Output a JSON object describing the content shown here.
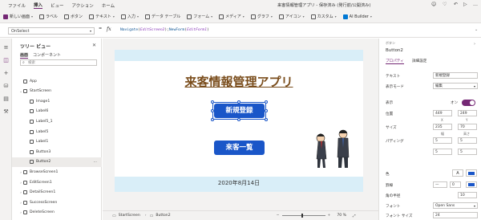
{
  "titlebar": {
    "menus": [
      "ファイル",
      "挿入",
      "ビュー",
      "アクション",
      "ホーム"
    ],
    "active_menu": "挿入",
    "doc_title": "来客情報管理アプリ - 保存済み (発行前/公開済み)"
  },
  "ribbon": {
    "items": [
      {
        "label": "新しい画面",
        "icon": "new-screen-icon",
        "color": "#742774"
      },
      {
        "label": "ラベル",
        "icon": "label-icon",
        "color": "#555555"
      },
      {
        "label": "ボタン",
        "icon": "button-icon",
        "color": "#555555"
      },
      {
        "label": "テキスト",
        "icon": "text-icon",
        "color": "#555555"
      },
      {
        "label": "入力",
        "icon": "input-icon",
        "color": "#555555"
      },
      {
        "label": "データ テーブル",
        "icon": "data-table-icon",
        "color": "#555555"
      },
      {
        "label": "フォーム",
        "icon": "form-icon",
        "color": "#555555"
      },
      {
        "label": "メディア",
        "icon": "media-icon",
        "color": "#555555"
      },
      {
        "label": "グラフ",
        "icon": "chart-icon",
        "color": "#555555"
      },
      {
        "label": "アイコン",
        "icon": "icons-icon",
        "color": "#555555"
      },
      {
        "label": "カスタム",
        "icon": "custom-icon",
        "color": "#555555"
      },
      {
        "label": "AI Builder",
        "icon": "ai-builder-icon",
        "color": "#0078d4"
      }
    ]
  },
  "formula": {
    "property": "OnSelect",
    "equals": "=",
    "fx": "fx",
    "func1": "Navigate",
    "arg1": "EditScreen2",
    "func2": "NewForm",
    "arg2": "EditForm1"
  },
  "tree": {
    "title": "ツリー ビュー",
    "tabs": [
      "画面",
      "コンポーネント"
    ],
    "search_placeholder": "検索",
    "items": [
      {
        "label": "App",
        "level": 0
      },
      {
        "label": "StartScreen",
        "level": 0
      },
      {
        "label": "Image1",
        "level": 1
      },
      {
        "label": "Label6",
        "level": 1
      },
      {
        "label": "Label5_1",
        "level": 1
      },
      {
        "label": "Label5",
        "level": 1
      },
      {
        "label": "Label1",
        "level": 1
      },
      {
        "label": "Button3",
        "level": 1
      },
      {
        "label": "Button2",
        "level": 1,
        "selected": true
      },
      {
        "label": "BrowseScreen1",
        "level": 0
      },
      {
        "label": "EditScreen1",
        "level": 0
      },
      {
        "label": "DetailScreen1",
        "level": 0
      },
      {
        "label": "SuccessScreen",
        "level": 0
      },
      {
        "label": "DeleteScreen",
        "level": 0
      }
    ]
  },
  "app": {
    "title": "来客情報管理アプリ",
    "register_button": "新規登録",
    "list_button": "来客一覧",
    "date": "2020年8月14日"
  },
  "statusbar": {
    "screen": "StartScreen",
    "control": "Button2",
    "zoom": "70 %"
  },
  "props": {
    "type": "ボタン",
    "name": "Button2",
    "tabs": [
      "プロパティ",
      "詳細設定"
    ],
    "text_label": "テキスト",
    "text_value": "新規登録",
    "display_mode_label": "表示モード",
    "display_mode_value": "編集",
    "visible_label": "表示",
    "visible_value": "オン",
    "position_label": "位置",
    "x": "449",
    "y": "249",
    "x_label": "X",
    "y_label": "Y",
    "size_label": "サイズ",
    "width": "235",
    "height": "70",
    "w_label": "幅",
    "h_label": "高さ",
    "padding_label": "パディング",
    "pad_top": "5",
    "pad_bottom": "5",
    "pad_left": "5",
    "pad_right": "5",
    "color_label": "色",
    "border_label": "罫線",
    "border_value": "0",
    "radius_label": "角の半径",
    "radius_value": "10",
    "font_label": "フォント",
    "font_value": "Open Sans",
    "fontsize_label": "フォント サイズ",
    "fontsize_value": "24"
  }
}
